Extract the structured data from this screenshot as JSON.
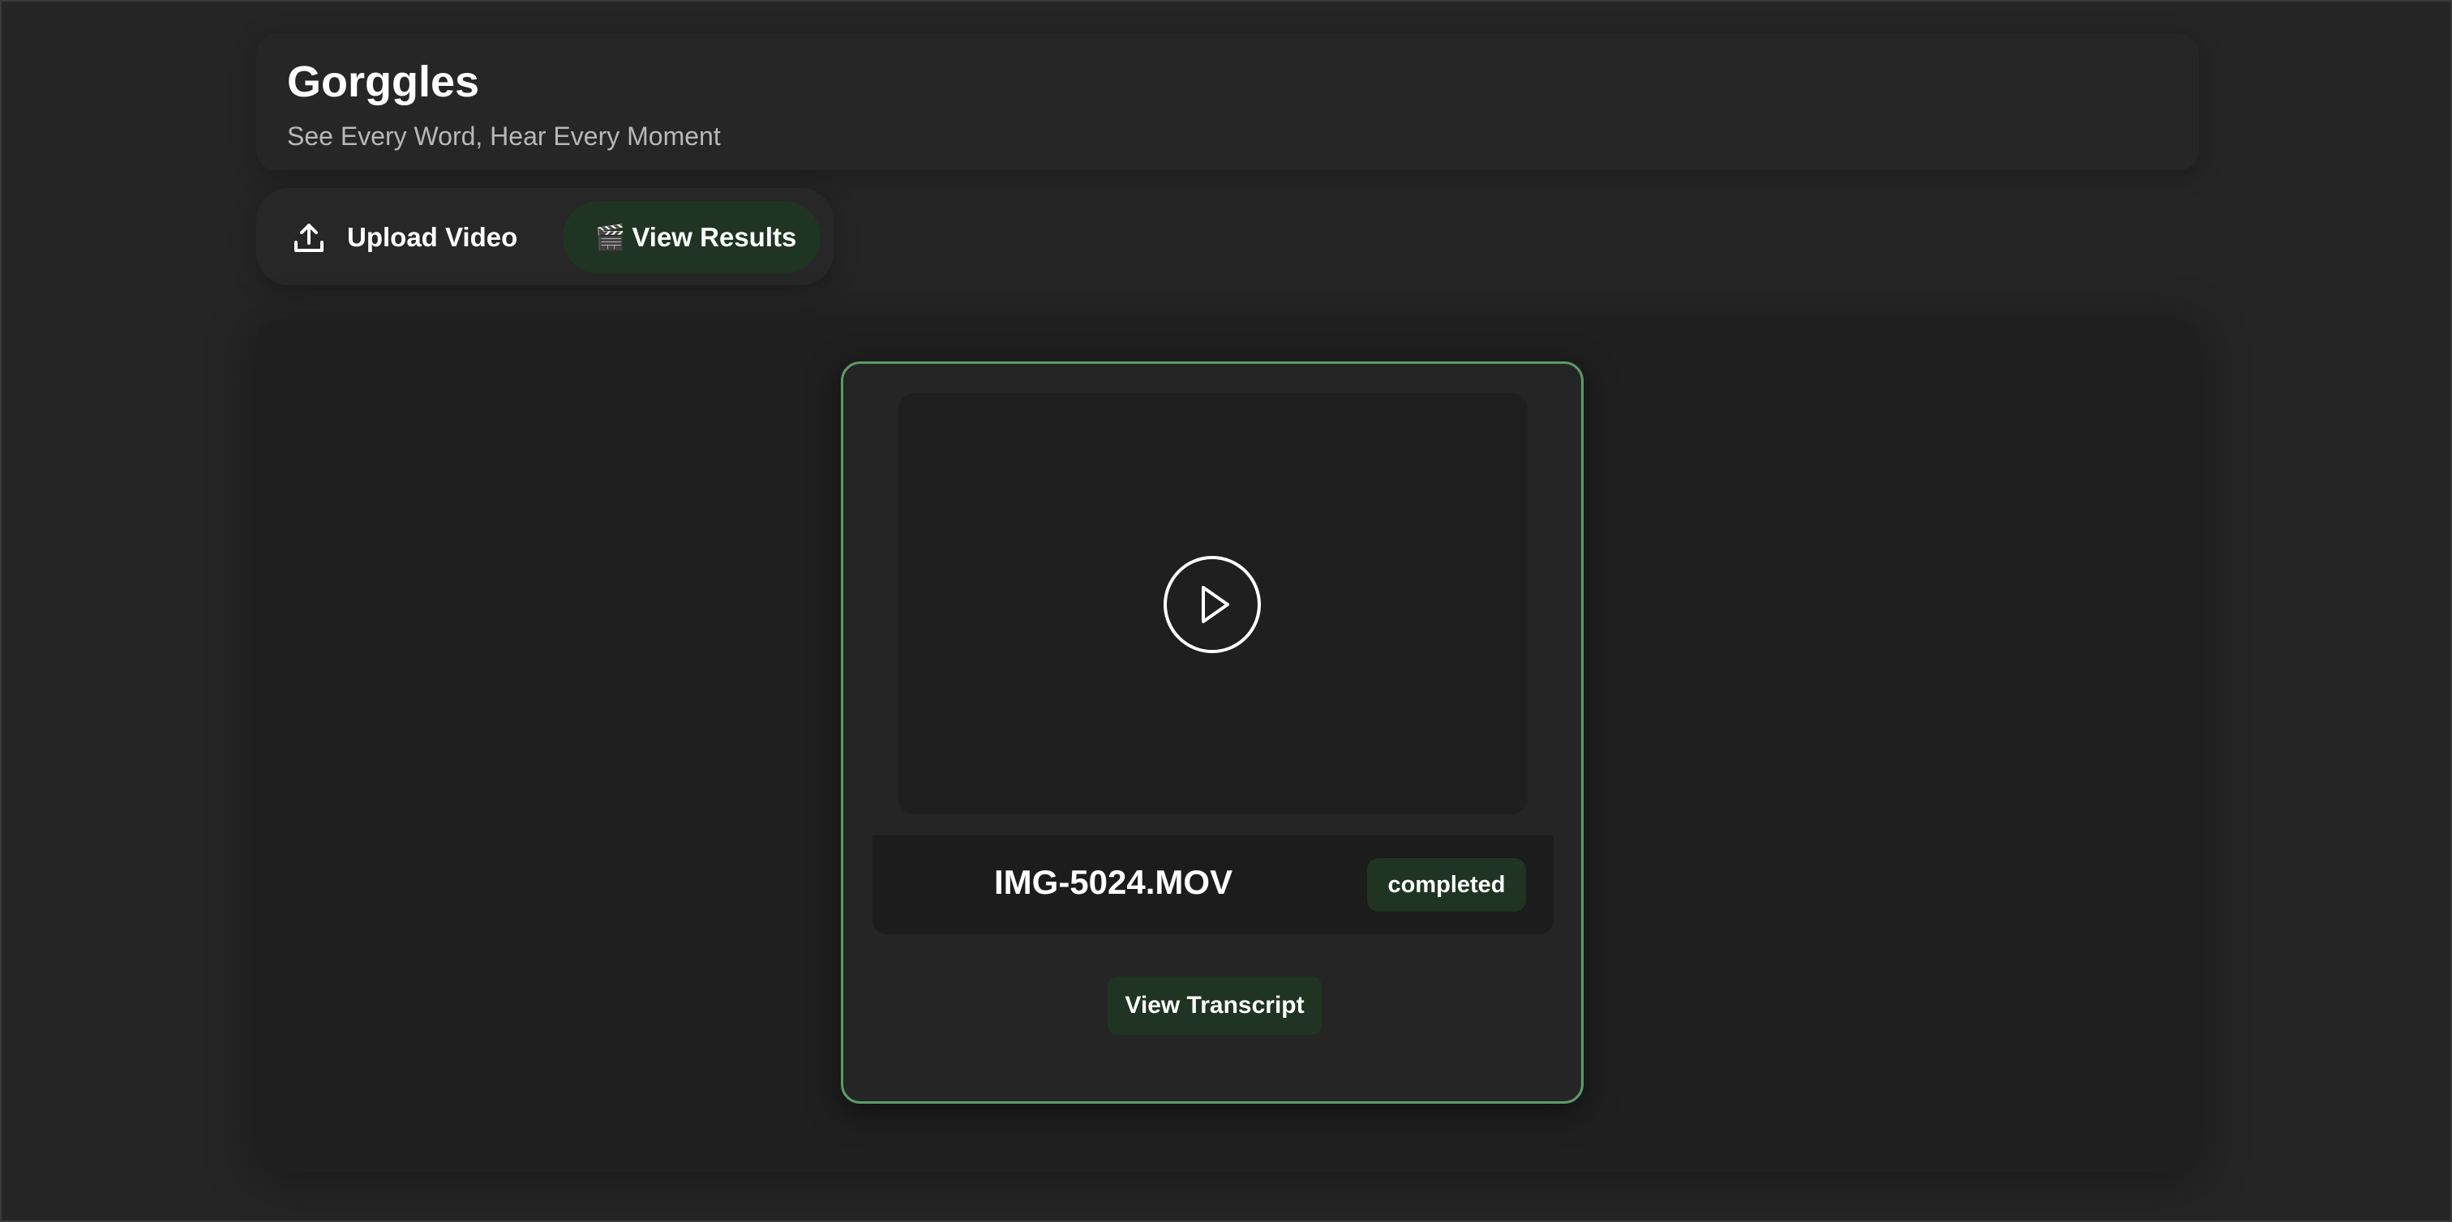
{
  "app": {
    "title": "Gorggles",
    "subtitle": "See Every Word, Hear Every Moment"
  },
  "tabs": [
    {
      "label": "Upload Video",
      "icon": "upload-icon",
      "active": false
    },
    {
      "label": "View Results",
      "icon": "🎬",
      "active": true
    }
  ],
  "video_card": {
    "filename": "IMG-5024.MOV",
    "status": "completed",
    "play_icon": "play-circle-icon",
    "transcript_button_label": "View Transcript"
  },
  "colors": {
    "accent_green": "#5a9c68",
    "active_bg": "#1f3422",
    "background": "#252525"
  }
}
